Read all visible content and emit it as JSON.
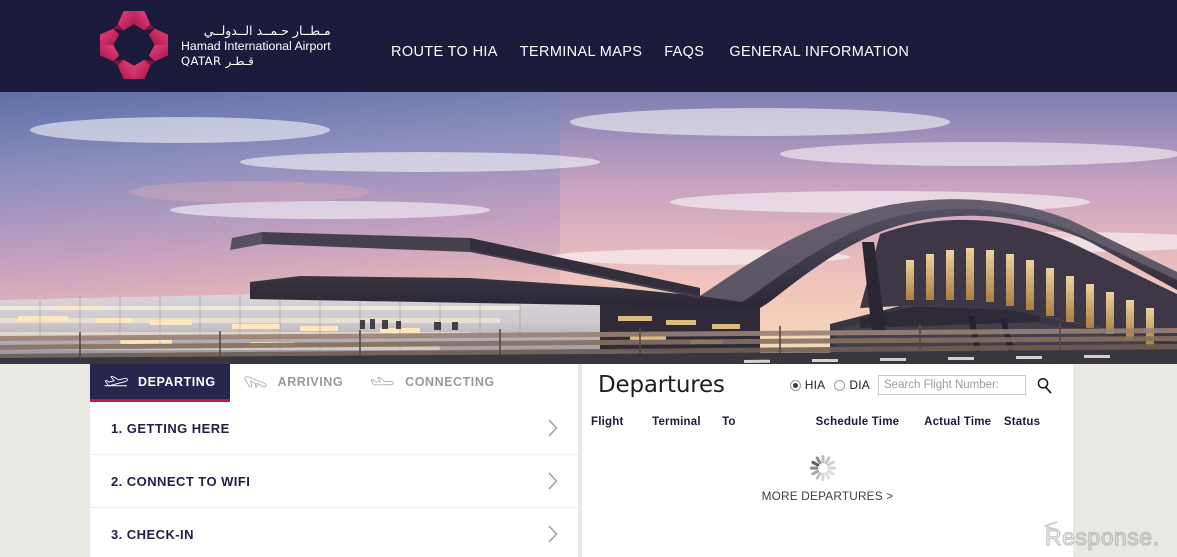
{
  "theme": {
    "header_bg": "#1d1b3c",
    "accent_pink": "#c8125c",
    "logo_pink": "#d6306b",
    "page_bg": "#e9e8e3",
    "panel_bg": "#ffffff",
    "text_dark": "#211f46",
    "tab_inactive": "#9a9a9a"
  },
  "header": {
    "logo": {
      "icon": "hia-star-logo-icon",
      "arabic_name": "مـطــار حـمــد الــدولــي",
      "english_name": "Hamad International Airport",
      "country_line": "QATAR قـطـر"
    },
    "nav": [
      {
        "label": "ROUTE TO HIA",
        "name": "nav-route-to-hia"
      },
      {
        "label": "TERMINAL MAPS",
        "name": "nav-terminal-maps"
      },
      {
        "label": "FAQS",
        "name": "nav-faqs"
      },
      {
        "label": "GENERAL INFORMATION",
        "name": "nav-general-information"
      }
    ]
  },
  "hero": {
    "alt": "Hamad International Airport terminal at dusk",
    "name": "hero-image"
  },
  "flight_tabs": [
    {
      "label": "DEPARTING",
      "icon": "plane-takeoff-icon",
      "active": true
    },
    {
      "label": "ARRIVING",
      "icon": "plane-landing-icon",
      "active": false
    },
    {
      "label": "CONNECTING",
      "icon": "plane-level-icon",
      "active": false
    }
  ],
  "steps": [
    {
      "label": "1. GETTING HERE"
    },
    {
      "label": "2. CONNECT TO WIFI"
    },
    {
      "label": "3. CHECK-IN"
    }
  ],
  "departures": {
    "title": "Departures",
    "airport_options": [
      {
        "label": "HIA",
        "selected": true
      },
      {
        "label": "DIA",
        "selected": false
      }
    ],
    "search_placeholder": "Search Flight Number:",
    "search_value": "",
    "search_icon": "magnifier-icon",
    "columns": [
      "Flight",
      "Terminal",
      "To",
      "Schedule Time",
      "Actual Time",
      "Status"
    ],
    "rows": [],
    "loading": true,
    "loading_icon": "spinner-icon",
    "more_link": "MORE DEPARTURES >"
  },
  "watermark": {
    "text": "Response.",
    "name": "response-watermark"
  }
}
